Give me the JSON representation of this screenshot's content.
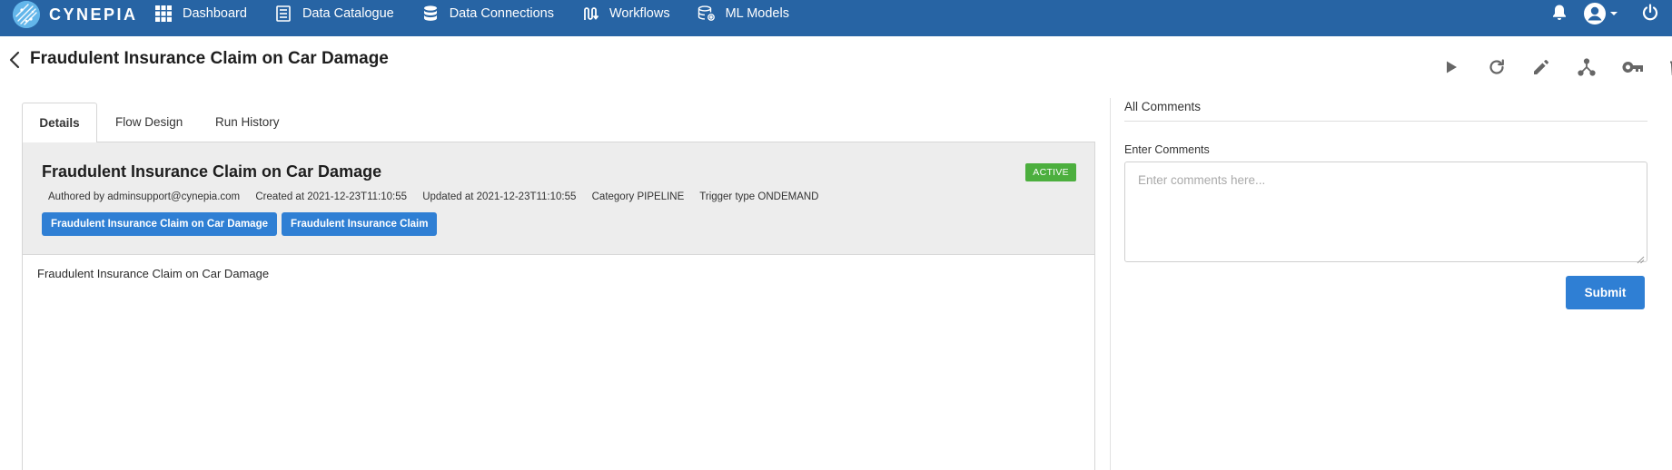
{
  "brand": {
    "name": "CYNEPIA"
  },
  "nav": {
    "items": [
      {
        "label": "Dashboard",
        "icon": "grid-icon"
      },
      {
        "label": "Data Catalogue",
        "icon": "catalogue-icon"
      },
      {
        "label": "Data Connections",
        "icon": "database-icon"
      },
      {
        "label": "Workflows",
        "icon": "workflow-icon"
      },
      {
        "label": "ML Models",
        "icon": "ml-models-icon"
      }
    ],
    "right_icons": [
      "bell-icon",
      "user-account-icon",
      "power-icon"
    ]
  },
  "page": {
    "title": "Fraudulent Insurance Claim on Car Damage",
    "toolbar_icons": [
      "play-icon",
      "refresh-icon",
      "edit-icon",
      "fork-icon",
      "key-icon",
      "trash-icon"
    ]
  },
  "tabs": [
    {
      "label": "Details",
      "active": true
    },
    {
      "label": "Flow Design",
      "active": false
    },
    {
      "label": "Run History",
      "active": false
    }
  ],
  "details": {
    "title": "Fraudulent Insurance Claim on Car Damage",
    "status": "ACTIVE",
    "authored": "Authored by adminsupport@cynepia.com",
    "created": "Created at 2021-12-23T11:10:55",
    "updated": "Updated at 2021-12-23T11:10:55",
    "category": "Category PIPELINE",
    "trigger": "Trigger type ONDEMAND",
    "tags": [
      "Fraudulent Insurance Claim on Car Damage",
      "Fraudulent Insurance Claim"
    ],
    "description": "Fraudulent Insurance Claim on Car Damage"
  },
  "comments": {
    "heading": "All Comments",
    "input_label": "Enter Comments",
    "placeholder": "Enter comments here...",
    "submit_label": "Submit"
  },
  "colors": {
    "nav_bg": "#2764a4",
    "primary_button": "#2f7fd4",
    "status_active": "#4caf3e",
    "summary_bg": "#ededed"
  }
}
